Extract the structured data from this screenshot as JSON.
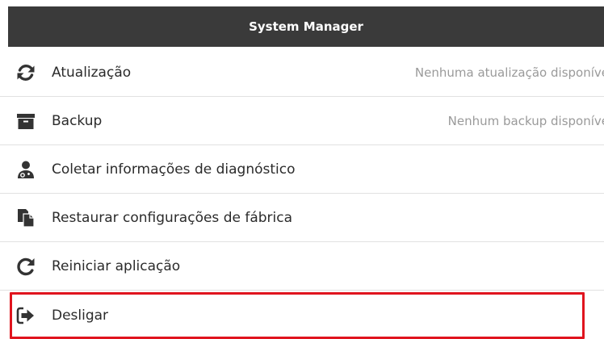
{
  "header": {
    "title": "System Manager"
  },
  "menu": {
    "items": [
      {
        "label": "Atualização",
        "status": "Nenhuma atualização disponíve",
        "icon": "refresh-icon"
      },
      {
        "label": "Backup",
        "status": "Nenhum backup disponíve",
        "icon": "archive-icon"
      },
      {
        "label": "Coletar informações de diagnóstico",
        "status": "",
        "icon": "user-doctor-icon"
      },
      {
        "label": "Restaurar configurações de fábrica",
        "status": "",
        "icon": "copy-document-icon"
      },
      {
        "label": "Reiniciar aplicação",
        "status": "",
        "icon": "redo-icon"
      },
      {
        "label": "Desligar",
        "status": "",
        "icon": "sign-out-icon"
      }
    ]
  },
  "colors": {
    "header_bg": "#3a3a3a",
    "highlight_border": "#e0141e",
    "status_text": "#9a9a9a"
  }
}
